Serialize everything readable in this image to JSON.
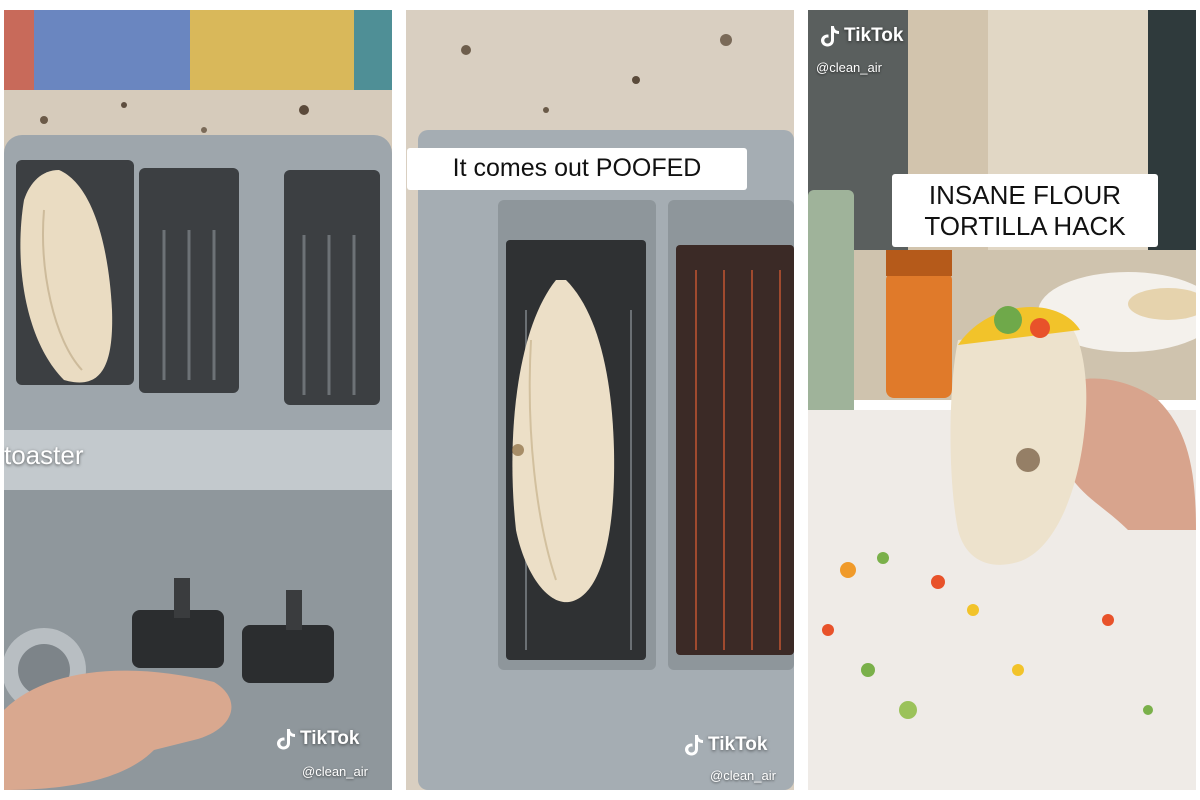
{
  "panels": [
    {
      "overlay_text": "toaster",
      "watermark": {
        "brand": "TikTok",
        "handle": "@clean_air"
      }
    },
    {
      "caption": "It comes out POOFED",
      "watermark": {
        "brand": "TikTok",
        "handle": "@clean_air"
      }
    },
    {
      "caption_line1": "INSANE FLOUR",
      "caption_line2": "TORTILLA HACK",
      "watermark": {
        "brand": "TikTok",
        "handle": "@clean_air"
      }
    }
  ],
  "icons": [
    "tiktok-logo-icon"
  ],
  "colors": {
    "steel": "#9aa2a8",
    "tortilla": "#e9dcc3",
    "granite": "#d8cfc2"
  }
}
